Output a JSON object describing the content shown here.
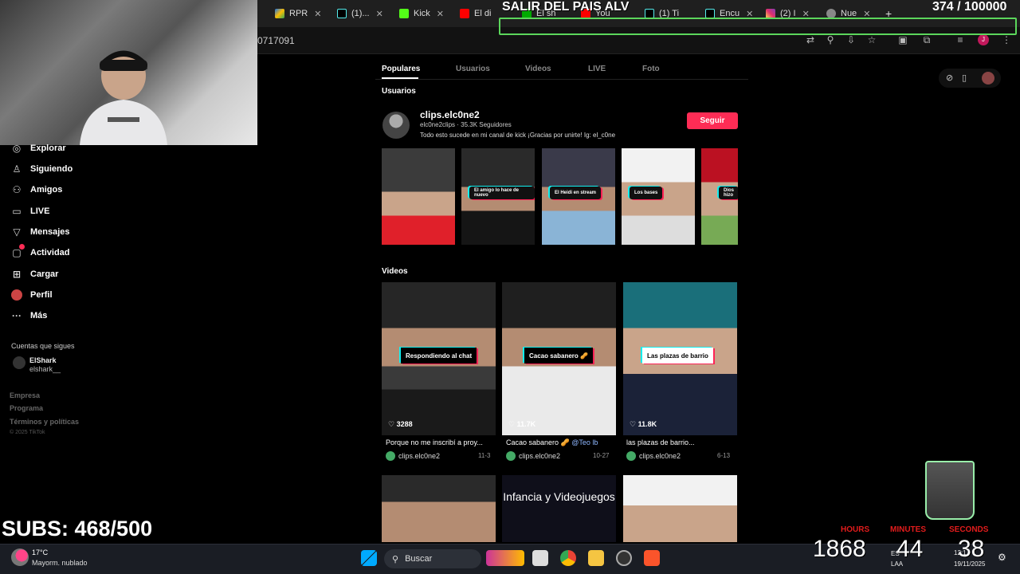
{
  "browser": {
    "tabs": [
      {
        "label": "RPR"
      },
      {
        "label": "(1)..."
      },
      {
        "label": "Kick"
      },
      {
        "label": "El di"
      },
      {
        "label": "El sh"
      },
      {
        "label": "You"
      },
      {
        "label": "(1) Ti"
      },
      {
        "label": "Encu"
      },
      {
        "label": "(2) I"
      },
      {
        "label": "Nue"
      }
    ],
    "url": "0717091"
  },
  "stream": {
    "goal_banner": "SALIR DEL PAIS ALV",
    "goal_counter": "374  / 100000",
    "subs": "SUBS: 468/500",
    "timer": {
      "hours_label": "HOURS",
      "minutes_label": "MINUTES",
      "seconds_label": "SECONDS",
      "hours": "1868",
      "minutes": "44",
      "seconds": "38"
    }
  },
  "sidebar": {
    "items": [
      {
        "label": "Explorar",
        "icon": "compass-icon"
      },
      {
        "label": "Siguiendo",
        "icon": "person-icon"
      },
      {
        "label": "Amigos",
        "icon": "friends-icon"
      },
      {
        "label": "LIVE",
        "icon": "live-tv-icon"
      },
      {
        "label": "Mensajes",
        "icon": "send-icon"
      },
      {
        "label": "Actividad",
        "icon": "inbox-icon"
      },
      {
        "label": "Cargar",
        "icon": "plus-square-icon"
      },
      {
        "label": "Perfil",
        "icon": "avatar-icon"
      },
      {
        "label": "Más",
        "icon": "more-icon"
      }
    ],
    "following_title": "Cuentas que sigues",
    "following": {
      "name": "ElShark",
      "handle": "elshark__"
    },
    "footer": {
      "company": "Empresa",
      "program": "Programa",
      "terms": "Términos y políticas",
      "copyright": "© 2025 TikTok"
    }
  },
  "search": {
    "tabs": [
      "Populares",
      "Usuarios",
      "Videos",
      "LIVE",
      "Foto"
    ],
    "active_tab": "Populares",
    "users_section": "Usuarios",
    "videos_section": "Videos"
  },
  "user": {
    "name": "clips.elc0ne2",
    "sub": "elc0ne2clips · 35.3K Seguidores",
    "bio": "Todo esto sucede en mi canal de kick ¡Gracias por unirte! Ig: el_c0ne",
    "follow_label": "Seguir"
  },
  "user_thumbs": [
    {
      "sticker": ""
    },
    {
      "sticker": "El amigo lo hace de nuevo"
    },
    {
      "sticker": "El Heidi en stream"
    },
    {
      "sticker": "Los bases"
    },
    {
      "sticker": "Dios hizo"
    }
  ],
  "videos": [
    {
      "caption": "Respondiendo al chat",
      "likes": "3288",
      "title": "Porque no me inscribí a proy...",
      "author": "clips.elc0ne2",
      "date": "11-3"
    },
    {
      "caption": "Cacao sabanero 🥜",
      "likes": "11.7K",
      "title": "Cacao sabanero 🥜",
      "mention": "@Teo lb",
      "author": "clips.elc0ne2",
      "date": "10-27"
    },
    {
      "caption": "Las plazas de barrio",
      "likes": "11.8K",
      "title": "las plazas de barrio...",
      "author": "clips.elc0ne2",
      "date": "6-13"
    }
  ],
  "videos_row2": [
    {
      "caption": ""
    },
    {
      "caption": "Infancia y Videojuegos"
    },
    {
      "caption": ""
    }
  ],
  "taskbar": {
    "weather_temp": "17°C",
    "weather_desc": "Mayorm. nublado",
    "search_label": "Buscar",
    "lang_top": "ES",
    "lang_bottom": "LAA",
    "time": "12:1",
    "date": "19/11/2025"
  },
  "colors": {
    "follow_button": "#fe2c55",
    "goal_box": "#5bd65b",
    "timer_labels": "#e21c1c"
  }
}
